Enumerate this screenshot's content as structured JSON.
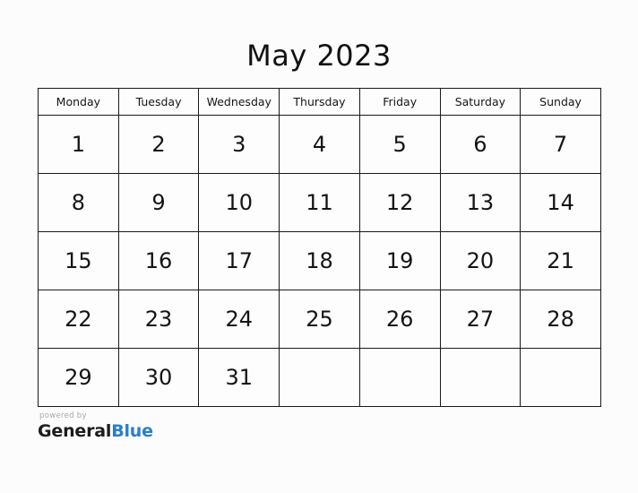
{
  "calendar": {
    "title": "May 2023",
    "weekdays": [
      "Monday",
      "Tuesday",
      "Wednesday",
      "Thursday",
      "Friday",
      "Saturday",
      "Sunday"
    ],
    "weeks": [
      [
        "1",
        "2",
        "3",
        "4",
        "5",
        "6",
        "7"
      ],
      [
        "8",
        "9",
        "10",
        "11",
        "12",
        "13",
        "14"
      ],
      [
        "15",
        "16",
        "17",
        "18",
        "19",
        "20",
        "21"
      ],
      [
        "22",
        "23",
        "24",
        "25",
        "26",
        "27",
        "28"
      ],
      [
        "29",
        "30",
        "31",
        "",
        "",
        "",
        ""
      ]
    ]
  },
  "footer": {
    "powered_by": "powered by",
    "brand_first": "General",
    "brand_second": "Blue",
    "brand_accent_color": "#2a7dc9"
  },
  "theme": {
    "page_background": "#fcfcfc",
    "cell_background": "#fdfdfd",
    "border_color": "#1a1a1a",
    "text_color": "#141414",
    "muted_text_color": "#a8a8a8"
  }
}
